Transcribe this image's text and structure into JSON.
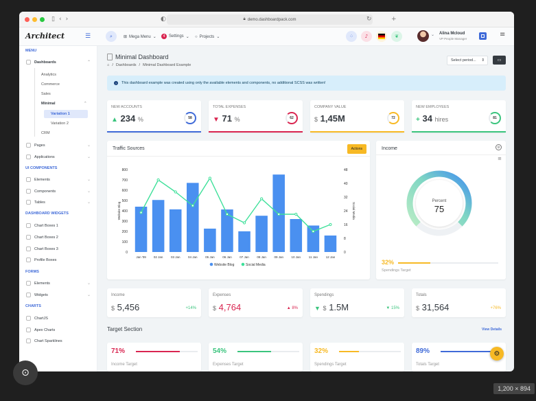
{
  "browser": {
    "url": "demo.dashboardpack.com"
  },
  "header": {
    "logo": "Architect",
    "mega_menu": "Mega Menu",
    "settings": "Settings",
    "settings_badge": "4",
    "projects": "Projects",
    "user_name": "Alina Mcloud",
    "user_role": "VP People Manager"
  },
  "sidebar": {
    "menu_heading": "MENU",
    "dashboards": "Dashboards",
    "analytics": "Analytics",
    "commerce": "Commerce",
    "sales": "Sales",
    "minimal": "Minimal",
    "variation1": "Variation 1",
    "variation2": "Variation 2",
    "crm": "CRM",
    "pages": "Pages",
    "applications": "Applications",
    "ui_heading": "UI COMPONENTS",
    "elements": "Elements",
    "components": "Components",
    "tables": "Tables",
    "widgets_heading": "DASHBOARD WIDGETS",
    "chart_boxes1": "Chart Boxes 1",
    "chart_boxes2": "Chart Boxes 2",
    "chart_boxes3": "Chart Boxes 3",
    "profile_boxes": "Profile Boxes",
    "forms_heading": "FORMS",
    "form_elements": "Elements",
    "form_widgets": "Widgets",
    "charts_heading": "CHARTS",
    "chartjs": "ChartJS",
    "apex": "Apex Charts",
    "sparklines": "Chart Sparklines"
  },
  "page": {
    "title": "Minimal Dashboard",
    "crumb1": "Dashboards",
    "crumb2": "Minimal Dashboard Example",
    "select_period": "Select period...",
    "alert": "This dashboard example was created using only the available elements and components, no additional SCSS was written!"
  },
  "kpis": [
    {
      "label": "NEW ACCOUNTS",
      "value": "234",
      "unit": "%",
      "ring": "58",
      "arrow": "▲"
    },
    {
      "label": "TOTAL EXPENSES",
      "value": "71",
      "unit": "%",
      "ring": "62",
      "arrow": "▼"
    },
    {
      "label": "COMPANY VALUE",
      "value": "1,45M",
      "unit": "$",
      "ring": "72",
      "arrow": ""
    },
    {
      "label": "NEW EMPLOYEES",
      "value": "34",
      "unit": "hires",
      "ring": "81",
      "arrow": "+"
    }
  ],
  "traffic": {
    "title": "Traffic Sources",
    "actions": "Actions"
  },
  "income_card": {
    "title": "Income",
    "gauge_label": "Percent",
    "gauge_value": "75",
    "target_pct": "32%",
    "target_label": "Spendings Target",
    "target_fraction": 0.32
  },
  "stats": [
    {
      "label": "Income",
      "currency": "$",
      "value": "5,456",
      "change": "+14%"
    },
    {
      "label": "Expenses",
      "currency": "$",
      "value": "4,764",
      "change": "▲ 8%"
    },
    {
      "label": "Spendings",
      "currency": "$",
      "value": "1.5M",
      "change": "▼ 15%",
      "arrow": "▼"
    },
    {
      "label": "Totals",
      "currency": "$",
      "value": "31,564",
      "change": "+76%"
    }
  ],
  "target_section": {
    "title": "Target Section",
    "view_details": "View Details"
  },
  "targets": [
    {
      "pct": "71%",
      "label": "Income Target",
      "fraction": 0.71
    },
    {
      "pct": "54%",
      "label": "Expenses Target",
      "fraction": 0.54
    },
    {
      "pct": "32%",
      "label": "Spendings Target",
      "fraction": 0.32
    },
    {
      "pct": "89%",
      "label": "Totals Target",
      "fraction": 0.89
    }
  ],
  "colors": {
    "primary": "#3f6ad8",
    "danger": "#d92550",
    "warning": "#f7b924",
    "success": "#3ac47d",
    "bar": "#4a90f0",
    "line": "#3ee09a"
  },
  "image_size_label": "1,200 × 894",
  "chart_data": {
    "type": "bar",
    "categories": [
      "Jan '09",
      "02 Jan",
      "03 Jan",
      "04 Jan",
      "05 Jan",
      "06 Jan",
      "07 Jan",
      "08 Jan",
      "09 Jan",
      "10 Jan",
      "11 Jan",
      "12 Jan"
    ],
    "series": [
      {
        "name": "Website Blog",
        "type": "bar",
        "values": [
          440,
          505,
          414,
          671,
          227,
          413,
          201,
          352,
          752,
          320,
          257,
          160
        ]
      },
      {
        "name": "Social Media",
        "type": "line",
        "values": [
          23,
          42,
          35,
          27,
          43,
          22,
          17,
          31,
          22,
          22,
          12,
          16
        ]
      }
    ],
    "ylabel": "Website Blog",
    "y2label": "Social Media",
    "ylim": [
      0,
      800
    ],
    "y2lim": [
      0,
      48
    ],
    "yticks": [
      "0",
      "100",
      "200",
      "300",
      "400",
      "500",
      "600",
      "700",
      "800"
    ],
    "y2ticks": [
      "0",
      "8",
      "16",
      "24",
      "32",
      "40",
      "48"
    ]
  }
}
